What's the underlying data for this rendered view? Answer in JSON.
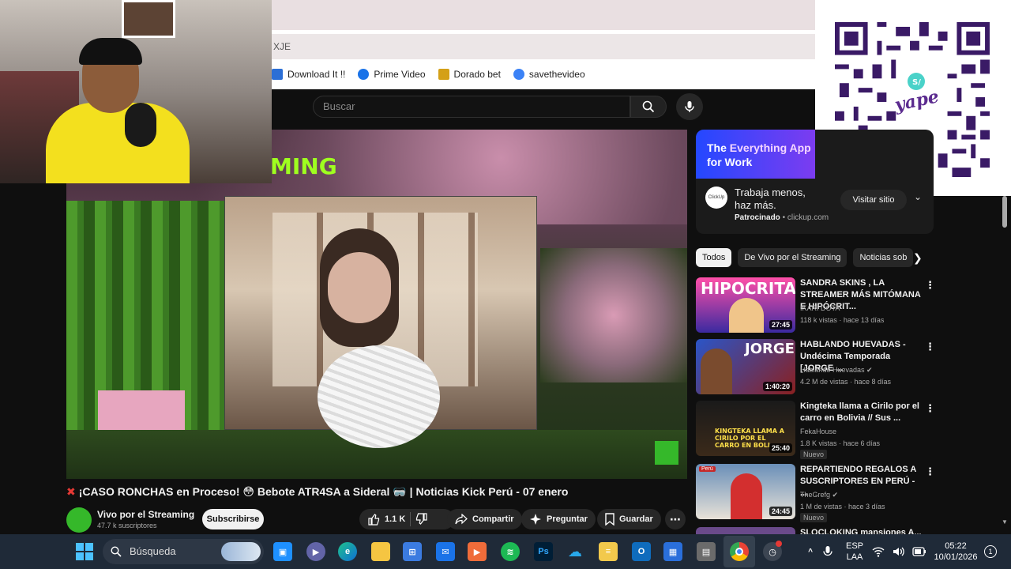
{
  "browser": {
    "address_fragment": "XJE",
    "bookmarks": [
      {
        "label": "Download It !!",
        "color": "#2b6fd6"
      },
      {
        "label": "Prime Video",
        "color": "#1a73e8"
      },
      {
        "label": "Dorado bet",
        "color": "#d4a017"
      },
      {
        "label": "savethevideo",
        "color": "#3b82f6"
      }
    ]
  },
  "youtube": {
    "search": {
      "placeholder": "Buscar"
    },
    "video": {
      "title": "¡CASO RONCHAS en Proceso! 😳 Bebote ATR4SA a Sideral 🥽 | Noticias Kick Perú - 07 enero",
      "overlay_text": "MING",
      "channel": {
        "name": "Vivo por el Streaming",
        "subscribers": "47.7 k suscriptores"
      },
      "subscribe_label": "Subscribirse",
      "likes": "1.1 K",
      "share_label": "Compartir",
      "ask_label": "Preguntar",
      "save_label": "Guardar"
    },
    "ad": {
      "banner_title_prefix": "The ",
      "banner_title_highlight": "Everything App",
      "banner_title_suffix": " for Work",
      "advertiser_short": "ClickUp",
      "text": "Trabaja menos, haz más.",
      "sponsored": "Patrocinado",
      "domain": "clickup.com",
      "visit_label": "Visitar sitio"
    },
    "chips": [
      {
        "label": "Todos",
        "active": true
      },
      {
        "label": "De Vivo por el Streaming",
        "active": false
      },
      {
        "label": "Noticias sob",
        "active": false
      }
    ],
    "recommendations": [
      {
        "title": "SANDRA SKINS , LA STREAMER MÁS MITÓMANA E HIPÓCRIT...",
        "channel": "IKARI DOTA",
        "meta": "118 k vistas · hace 13 días",
        "duration": "27:45",
        "thumb_text": "HIPOCRITA",
        "badge": ""
      },
      {
        "title": "HABLANDO HUEVADAS - Undécima Temporada [JORGE ...",
        "channel": "Hablando Huevadas ✔",
        "meta": "4.2 M de vistas · hace 8 días",
        "duration": "1:40:20",
        "thumb_text": "JORGE",
        "badge": ""
      },
      {
        "title": "Kingteka llama a Cirilo por el carro en Bolivia // Sus ...",
        "channel": "FekaHouse",
        "meta": "1.8 K vistas · hace 6 días",
        "duration": "25:40",
        "thumb_text": "KINGTEKA LLAMA A CIRILO POR EL CARRO EN BOLI",
        "badge": "Nuevo"
      },
      {
        "title": "REPARTIENDO REGALOS A SUSCRIPTORES EN PERÚ - ...",
        "channel": "TheGrefg ✔",
        "meta": "1 M de vistas · hace 3 días",
        "duration": "24:45",
        "thumb_text": "Perú",
        "badge": "Nuevo"
      }
    ],
    "partial_next_title": "SLOCLOKING mansiones A..."
  },
  "qr": {
    "brand": "yape"
  },
  "taskbar": {
    "search_label": "Búsqueda",
    "lang_line1": "ESP",
    "lang_line2": "LAA",
    "time": "05:22",
    "date": "10/01/2026",
    "notifications": "1"
  }
}
